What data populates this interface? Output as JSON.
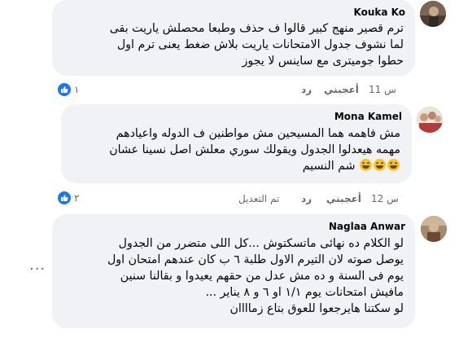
{
  "comments": [
    {
      "author": "Kouka Ko",
      "lines": [
        "ترم قصير منهج كبير قالوا ف حذف وطبعا محصلش ياريت بقى",
        "لما نشوف جدول الامتحانات ياريت بلاش ضغط يعنى ترم اول",
        "حطوا جوميترى مع ساينس لا يجوز"
      ],
      "time": "11 س",
      "like_label": "أعجبني",
      "reply_label": "رد",
      "reaction_count": "١"
    },
    {
      "author": "Mona Kamel",
      "lines": [
        "مش فاهمه هما المسيحين مش مواطنين ف الدوله واعيادهم",
        "مهمه هيعدلوا الجدول ويقولك سوري معلش اصل نسينا عشان",
        "شم النسيم"
      ],
      "emoji_count": 3,
      "time": "12 س",
      "like_label": "أعجبني",
      "reply_label": "رد",
      "edited_label": "تم التعديل",
      "reaction_count": "٢"
    },
    {
      "author": "Naglaa Anwar",
      "lines": [
        "لو الكلام ده نهائى ماتسكتوش ...كل اللى متضرر من الجدول",
        "يوصل صوته لان التيرم الاول طلبة ٦ ب كان عندهم امتحان اول",
        "يوم فى السنة و ده مش عدل من حقهم يعيدوا و بقالنا سنين",
        "مافيش امتحانات يوم ١/١ او ٦ و ٨ يناير ...",
        "لو سكتنا هايرجعوا للعوق بتاع زماااان"
      ],
      "more_label": "···"
    }
  ]
}
